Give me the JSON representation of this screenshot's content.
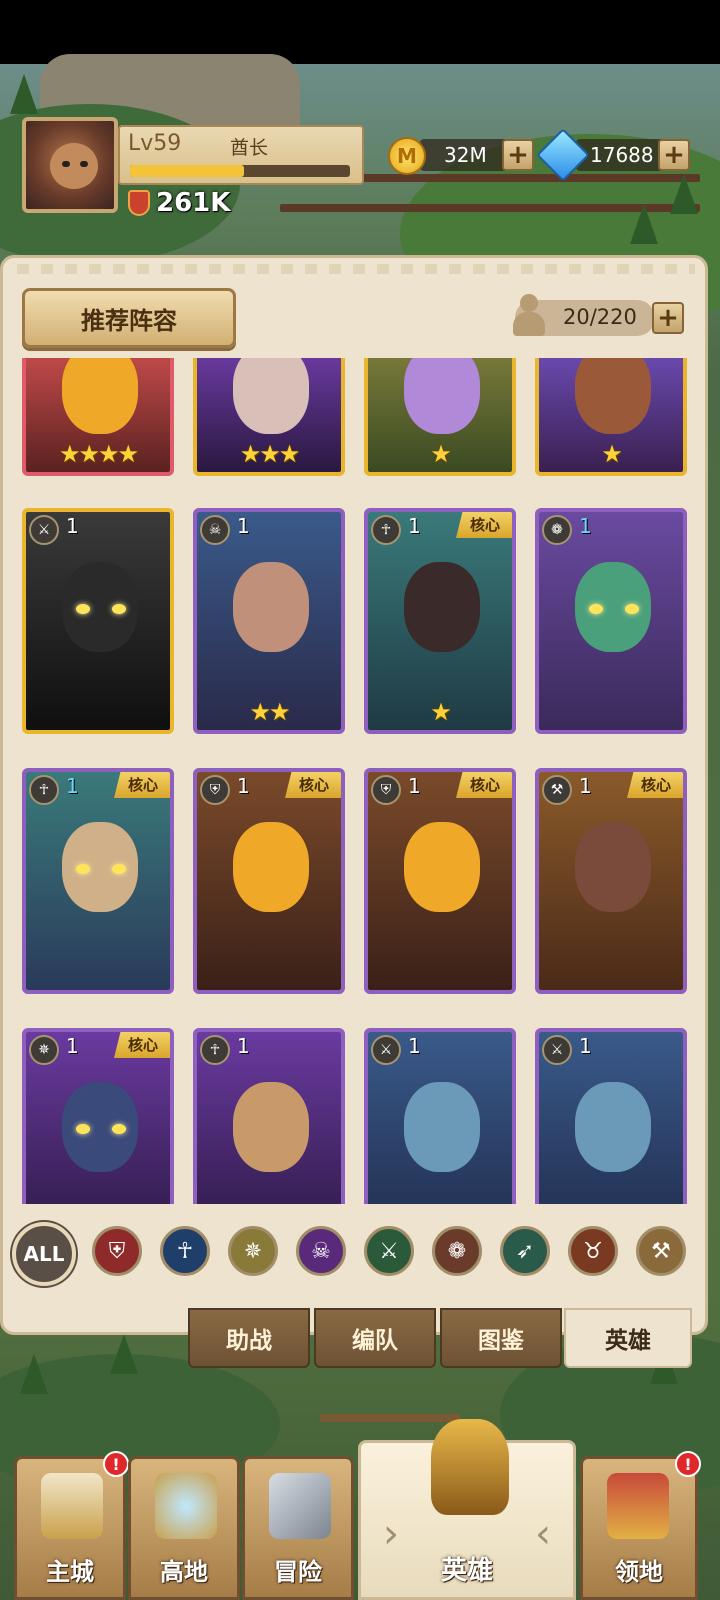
{
  "player": {
    "level_prefix": "Lv",
    "level": "59",
    "title": "酋长",
    "exp_fraction": 0.52,
    "power": "261K"
  },
  "resources": {
    "gold_icon": "M",
    "gold": "32M",
    "gems": "17688",
    "add_symbol": "+"
  },
  "panel": {
    "recommend_button": "推荐阵容",
    "capacity": "20/220"
  },
  "heroes": [
    {
      "level": "",
      "stars": "★★★★",
      "core": "",
      "frame": "red",
      "faction": "",
      "level_color": "white"
    },
    {
      "level": "",
      "stars": "★★★",
      "core": "",
      "frame": "gold",
      "faction": "",
      "level_color": "white"
    },
    {
      "level": "",
      "stars": "★",
      "core": "",
      "frame": "gold",
      "faction": "",
      "level_color": "white"
    },
    {
      "level": "",
      "stars": "★",
      "core": "",
      "frame": "gold",
      "faction": "",
      "level_color": "white"
    },
    {
      "level": "1",
      "stars": "",
      "core": "",
      "frame": "gold",
      "faction": "crossed-blades-icon",
      "level_color": "white"
    },
    {
      "level": "1",
      "stars": "★★",
      "core": "",
      "frame": "purple",
      "faction": "beast-skull-icon",
      "level_color": "white"
    },
    {
      "level": "1",
      "stars": "★",
      "core": "核心",
      "frame": "purple",
      "faction": "ankh-icon",
      "level_color": "white"
    },
    {
      "level": "1",
      "stars": "",
      "core": "",
      "frame": "purple",
      "faction": "paw-icon",
      "level_color": "blue"
    },
    {
      "level": "1",
      "stars": "",
      "core": "核心",
      "frame": "purple",
      "faction": "ankh-icon",
      "level_color": "blue"
    },
    {
      "level": "1",
      "stars": "",
      "core": "核心",
      "frame": "purple",
      "faction": "shield-icon",
      "level_color": "white"
    },
    {
      "level": "1",
      "stars": "",
      "core": "核心",
      "frame": "purple",
      "faction": "shield-icon",
      "level_color": "white"
    },
    {
      "level": "1",
      "stars": "",
      "core": "核心",
      "frame": "purple",
      "faction": "hammer-icon",
      "level_color": "white"
    },
    {
      "level": "1",
      "stars": "",
      "core": "核心",
      "frame": "purple",
      "faction": "holy-wings-icon",
      "level_color": "white"
    },
    {
      "level": "1",
      "stars": "",
      "core": "",
      "frame": "purple",
      "faction": "ankh-icon",
      "level_color": "white"
    },
    {
      "level": "1",
      "stars": "",
      "core": "",
      "frame": "purple",
      "faction": "crossed-blades-icon",
      "level_color": "white"
    },
    {
      "level": "1",
      "stars": "",
      "core": "",
      "frame": "purple",
      "faction": "crossed-blades-icon",
      "level_color": "white"
    }
  ],
  "filters": [
    {
      "label": "ALL",
      "icon": "all-filter",
      "color": "#5a4f47"
    },
    {
      "label": "",
      "icon": "shield-icon",
      "color": "#8e2a2a"
    },
    {
      "label": "",
      "icon": "ankh-icon",
      "color": "#1f3f6a"
    },
    {
      "label": "",
      "icon": "holy-wings-icon",
      "color": "#8a7a3a"
    },
    {
      "label": "",
      "icon": "skull-icon",
      "color": "#5a2a7a"
    },
    {
      "label": "",
      "icon": "crossed-blades-icon",
      "color": "#2a5a3a"
    },
    {
      "label": "",
      "icon": "paw-icon",
      "color": "#6a3a2a"
    },
    {
      "label": "",
      "icon": "bow-icon",
      "color": "#2a5a4a"
    },
    {
      "label": "",
      "icon": "beast-skull-icon",
      "color": "#7a3a22"
    },
    {
      "label": "",
      "icon": "hammer-icon",
      "color": "#8a6a3a"
    }
  ],
  "tabs": [
    "助战",
    "编队",
    "图鉴",
    "英雄"
  ],
  "nav": {
    "items": [
      "主城",
      "高地",
      "冒险",
      "英雄",
      "领地"
    ],
    "alert": "!"
  }
}
